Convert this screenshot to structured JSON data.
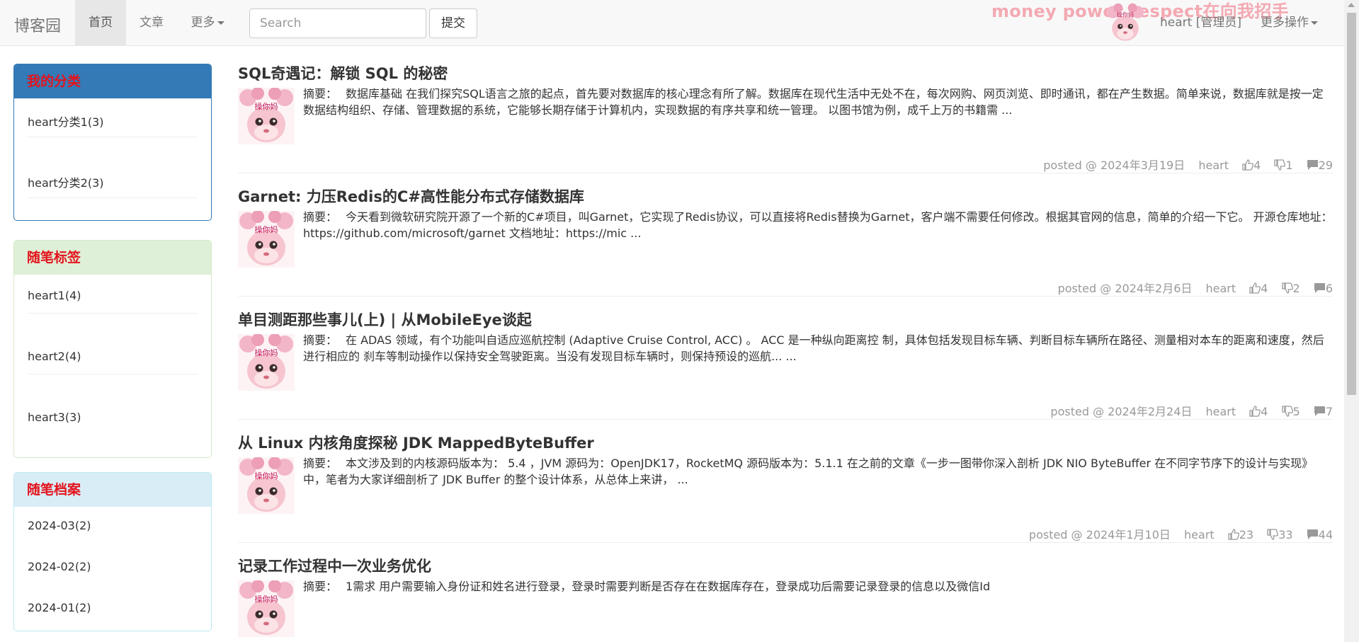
{
  "navbar": {
    "brand": "博客园",
    "items": [
      {
        "label": "首页",
        "active": true
      },
      {
        "label": "文章",
        "active": false
      },
      {
        "label": "更多",
        "active": false
      }
    ],
    "search_placeholder": "Search",
    "submit_label": "提交",
    "watermark": "money power respect在向我招手",
    "avatar_text": "操你妈",
    "user_label": "heart [管理员]",
    "more_ops_label": "更多操作"
  },
  "sidebar": {
    "categories": {
      "title": "我的分类",
      "items": [
        "heart分类1(3)",
        "heart分类2(3)"
      ]
    },
    "tags": {
      "title": "随笔标签",
      "items": [
        "heart1(4)",
        "heart2(4)",
        "heart3(3)"
      ]
    },
    "archives": {
      "title": "随笔档案",
      "items": [
        "2024-03(2)",
        "2024-02(2)",
        "2024-01(2)"
      ]
    }
  },
  "posts": [
    {
      "title": "SQL奇遇记：解锁 SQL 的秘密",
      "thumb_text": "操你妈",
      "summary_label": "摘要：",
      "summary": "数据库基础 在我们探究SQL语言之旅的起点，首先要对数据库的核心理念有所了解。数据库在现代生活中无处不在，每次网购、网页浏览、即时通讯，都在产生数据。简单来说，数据库就是按一定数据结构组织、存储、管理数据的系统，它能够长期存储于计算机内，实现数据的有序共享和统一管理。 以图书馆为例，成千上万的书籍需 ...",
      "date": "posted @ 2024年3月19日",
      "author": "heart",
      "likes": "4",
      "dislikes": "1",
      "comments": "29"
    },
    {
      "title": "Garnet: 力压Redis的C#高性能分布式存储数据库",
      "thumb_text": "操你妈",
      "summary_label": "摘要：",
      "summary": "今天看到微软研究院开源了一个新的C#项目，叫Garnet，它实现了Redis协议，可以直接将Redis替换为Garnet，客户端不需要任何修改。根据其官网的信息，简单的介绍一下它。 开源仓库地址：https://github.com/microsoft/garnet 文档地址：https://mic ...",
      "date": "posted @ 2024年2月6日",
      "author": "heart",
      "likes": "4",
      "dislikes": "2",
      "comments": "6"
    },
    {
      "title": "单目测距那些事儿(上) | 从MobileEye谈起",
      "thumb_text": "操你妈",
      "summary_label": "摘要：",
      "summary": "在 ADAS 领域，有个功能叫自适应巡航控制 (Adaptive Cruise Control, ACC) 。 ACC 是一种纵向距离控 制，具体包括发现目标车辆、判断目标车辆所在路径、测量相对本车的距离和速度，然后进行相应的 刹车等制动操作以保持安全驾驶距离。当没有发现目标车辆时，则保持预设的巡航... ...",
      "date": "posted @ 2024年2月24日",
      "author": "heart",
      "likes": "4",
      "dislikes": "5",
      "comments": "7"
    },
    {
      "title": "从 Linux 内核角度探秘 JDK MappedByteBuffer",
      "thumb_text": "操你妈",
      "summary_label": "摘要：",
      "summary": "本文涉及到的内核源码版本为： 5.4 ，JVM 源码为：OpenJDK17，RocketMQ 源码版本为：5.1.1 在之前的文章《一步一图带你深入剖析 JDK NIO ByteBuffer 在不同字节序下的设计与实现》 中，笔者为大家详细剖析了 JDK Buffer 的整个设计体系，从总体上来讲， ...",
      "date": "posted @ 2024年1月10日",
      "author": "heart",
      "likes": "23",
      "dislikes": "33",
      "comments": "44"
    },
    {
      "title": "记录工作过程中一次业务优化",
      "thumb_text": "操你妈",
      "summary_label": "摘要：",
      "summary": "1需求 用户需要输入身份证和姓名进行登录，登录时需要判断是否存在在数据库存在，登录成功后需要记录登录的信息以及微信Id"
    }
  ]
}
